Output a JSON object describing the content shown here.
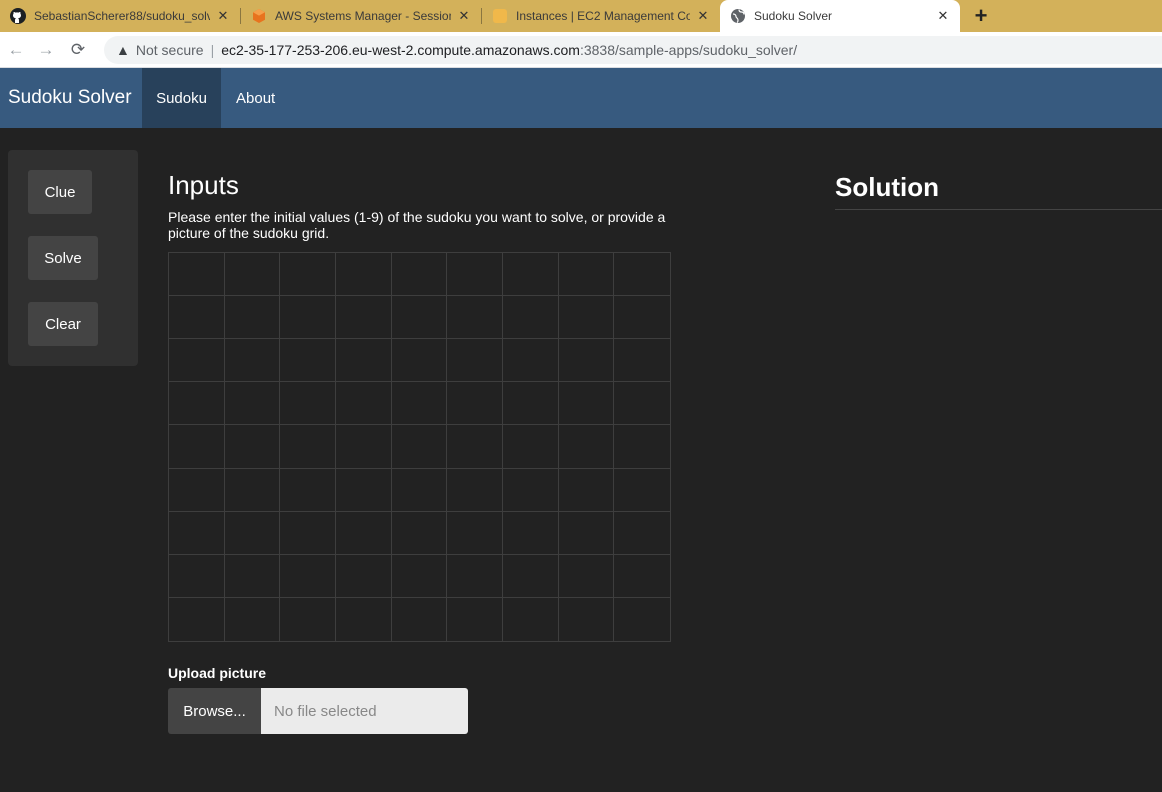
{
  "browser": {
    "tabs": [
      {
        "title": "SebastianScherer88/sudoku_solv",
        "icon": "github-icon"
      },
      {
        "title": "AWS Systems Manager - Session",
        "icon": "aws-icon"
      },
      {
        "title": "Instances | EC2 Management Co",
        "icon": "ec2-icon"
      },
      {
        "title": "Sudoku Solver",
        "icon": "globe-icon"
      }
    ],
    "close_glyph": "✕",
    "new_tab": "+",
    "security_label": "Not secure",
    "url_host": "ec2-35-177-253-206.eu-west-2.compute.amazonaws.com",
    "url_path": ":3838/sample-apps/sudoku_solver/"
  },
  "navbar": {
    "brand": "Sudoku Solver",
    "links": [
      "Sudoku",
      "About"
    ],
    "active": "Sudoku"
  },
  "sidebar": {
    "buttons": [
      "Clue",
      "Solve",
      "Clear"
    ]
  },
  "inputs": {
    "title": "Inputs",
    "instructions": "Please enter the initial values (1-9) of the sudoku you want to solve, or provide a picture of the sudoku grid.",
    "grid_values": [
      [
        "",
        "",
        "",
        "",
        "",
        "",
        "",
        "",
        ""
      ],
      [
        "",
        "",
        "",
        "",
        "",
        "",
        "",
        "",
        ""
      ],
      [
        "",
        "",
        "",
        "",
        "",
        "",
        "",
        "",
        ""
      ],
      [
        "",
        "",
        "",
        "",
        "",
        "",
        "",
        "",
        ""
      ],
      [
        "",
        "",
        "",
        "",
        "",
        "",
        "",
        "",
        ""
      ],
      [
        "",
        "",
        "",
        "",
        "",
        "",
        "",
        "",
        ""
      ],
      [
        "",
        "",
        "",
        "",
        "",
        "",
        "",
        "",
        ""
      ],
      [
        "",
        "",
        "",
        "",
        "",
        "",
        "",
        "",
        ""
      ],
      [
        "",
        "",
        "",
        "",
        "",
        "",
        "",
        "",
        ""
      ]
    ]
  },
  "upload": {
    "label": "Upload picture",
    "browse_label": "Browse...",
    "placeholder": "No file selected"
  },
  "solution": {
    "title": "Solution"
  },
  "colors": {
    "navbar": "#375a7f",
    "navbar_active": "#28415b",
    "background": "#222222",
    "panel": "#303030",
    "button": "#444444"
  }
}
